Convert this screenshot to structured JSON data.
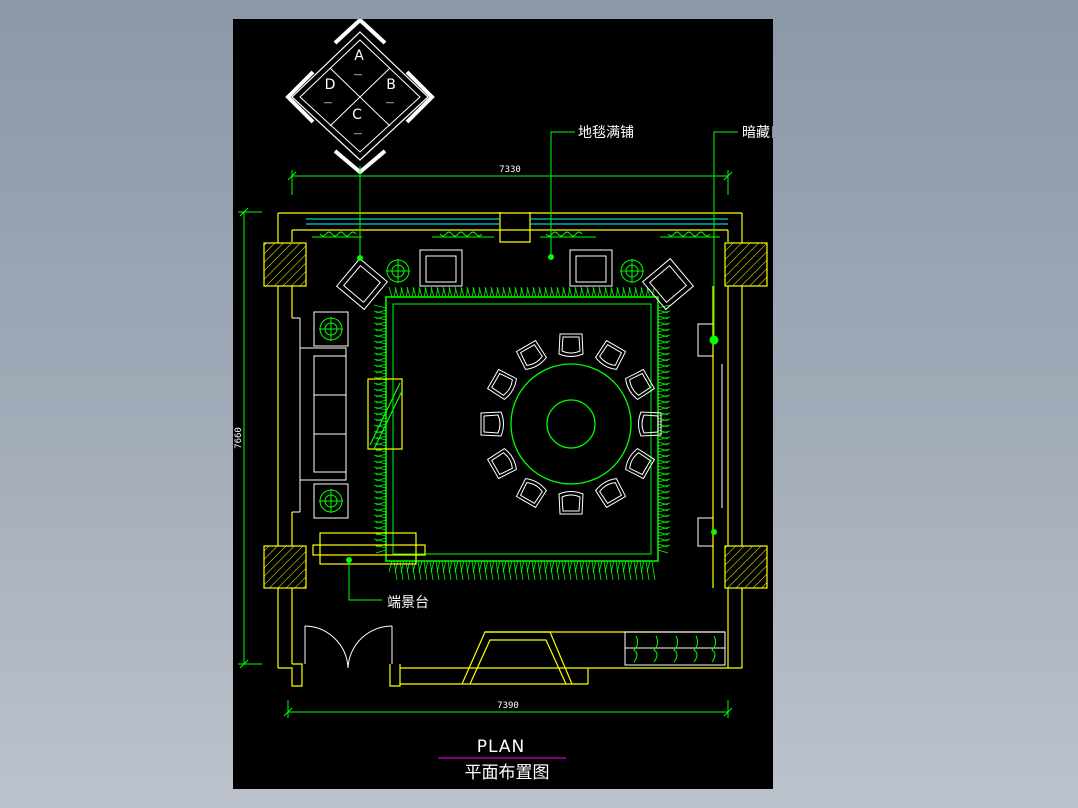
{
  "legend": {
    "top": "A",
    "right": "B",
    "bottom": "C",
    "left": "D",
    "dash": "—"
  },
  "labels": {
    "carpet": "地毯满铺",
    "lightstrip": "暗藏日光灯带",
    "feature_table": "端景台",
    "plan_en": "PLAN",
    "plan_cn": "平面布置图"
  },
  "dimensions": {
    "top_width": "7330",
    "bottom_width": "7390",
    "left_height": "7660"
  },
  "colors": {
    "background": "#000000",
    "wall": "#ffff00",
    "furniture": "#00ff00",
    "leader": "#00ff00",
    "dimension": "#00ff00",
    "text": "#ffffff",
    "underline": "#ff00ff",
    "window": "#00ffff"
  }
}
